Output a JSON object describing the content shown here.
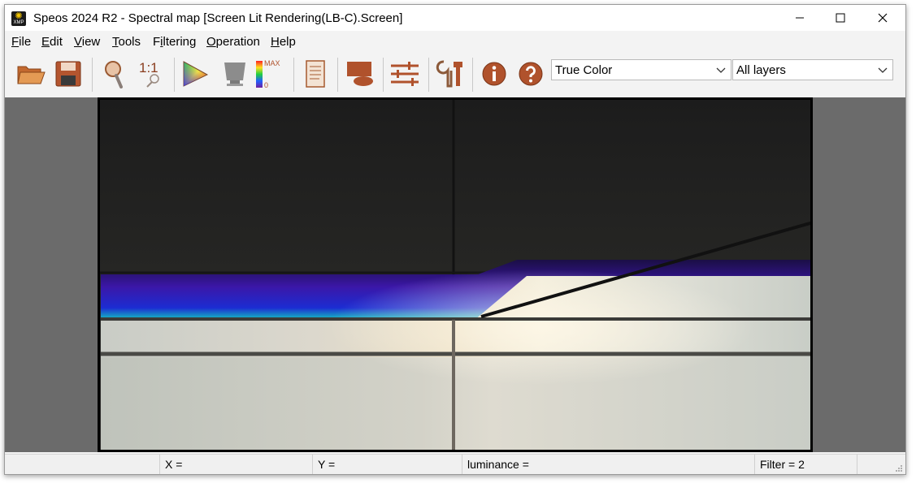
{
  "window": {
    "title": "Speos 2024 R2 - Spectral map [Screen Lit Rendering(LB-C).Screen]",
    "app_icon_text": "XMP",
    "controls": [
      "minimize",
      "maximize",
      "close"
    ]
  },
  "menu": {
    "items": [
      {
        "accel": "F",
        "rest": "ile"
      },
      {
        "accel": "E",
        "rest": "dit"
      },
      {
        "accel": "V",
        "rest": "iew"
      },
      {
        "accel": "T",
        "rest": "ools"
      },
      {
        "pre": "F",
        "accel": "i",
        "rest": "ltering"
      },
      {
        "accel": "O",
        "rest": "peration"
      },
      {
        "accel": "H",
        "rest": "elp"
      }
    ]
  },
  "toolbar": {
    "icons": [
      "open-folder-icon",
      "save-icon",
      "magnifier-icon",
      "zoom-1-1-icon",
      "color-triangle-icon",
      "display-icon",
      "color-scale-icon",
      "document-icon",
      "layer-shape-icon",
      "sliders-icon",
      "tools-icon",
      "info-icon",
      "help-icon"
    ],
    "zoom_label": "1:1",
    "scale_max_label": "MAX",
    "scale_min_label": "0",
    "color_mode": "True Color",
    "layer": "All layers",
    "accent_color": "#b0522c"
  },
  "status": {
    "x": "X =",
    "y": "Y =",
    "luminance": "luminance =",
    "filter": "Filter = 2"
  }
}
